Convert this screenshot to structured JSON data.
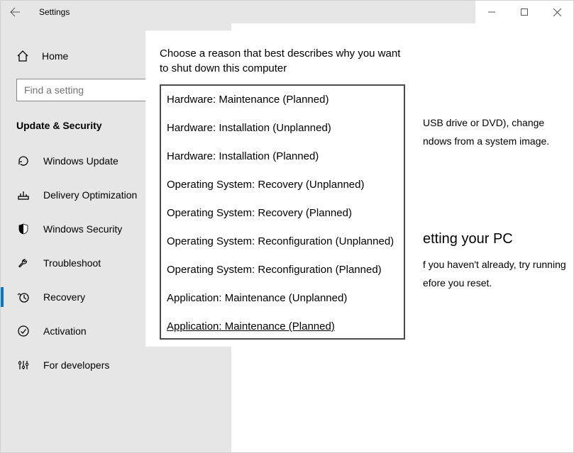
{
  "titlebar": {
    "title": "Settings"
  },
  "sidebar": {
    "home_label": "Home",
    "search_placeholder": "Find a setting",
    "category_header": "Update & Security",
    "items": [
      {
        "label": "Windows Update",
        "icon": "refresh-icon",
        "selected": false
      },
      {
        "label": "Delivery Optimization",
        "icon": "delivery-icon",
        "selected": false
      },
      {
        "label": "Windows Security",
        "icon": "shield-icon",
        "selected": false
      },
      {
        "label": "Troubleshoot",
        "icon": "wrench-icon",
        "selected": false
      },
      {
        "label": "Recovery",
        "icon": "clock-icon",
        "selected": true
      },
      {
        "label": "Activation",
        "icon": "check-circle-icon",
        "selected": false
      },
      {
        "label": "For developers",
        "icon": "sliders-icon",
        "selected": false
      }
    ]
  },
  "content": {
    "partial_line1": "USB drive or DVD), change",
    "partial_line2": "ndows from a system image.",
    "section_title_partial": "etting your PC",
    "tip_line1": "f you haven't already, try running",
    "tip_line2": "efore you reset."
  },
  "dialog": {
    "prompt": "Choose a reason that best describes why you want to shut down this computer",
    "options": [
      "Hardware: Maintenance (Planned)",
      "Hardware: Installation (Unplanned)",
      "Hardware: Installation (Planned)",
      "Operating System: Recovery (Unplanned)",
      "Operating System: Recovery (Planned)",
      "Operating System: Reconfiguration (Unplanned)",
      "Operating System: Reconfiguration (Planned)",
      "Application: Maintenance (Unplanned)",
      "Application: Maintenance (Planned)"
    ]
  }
}
